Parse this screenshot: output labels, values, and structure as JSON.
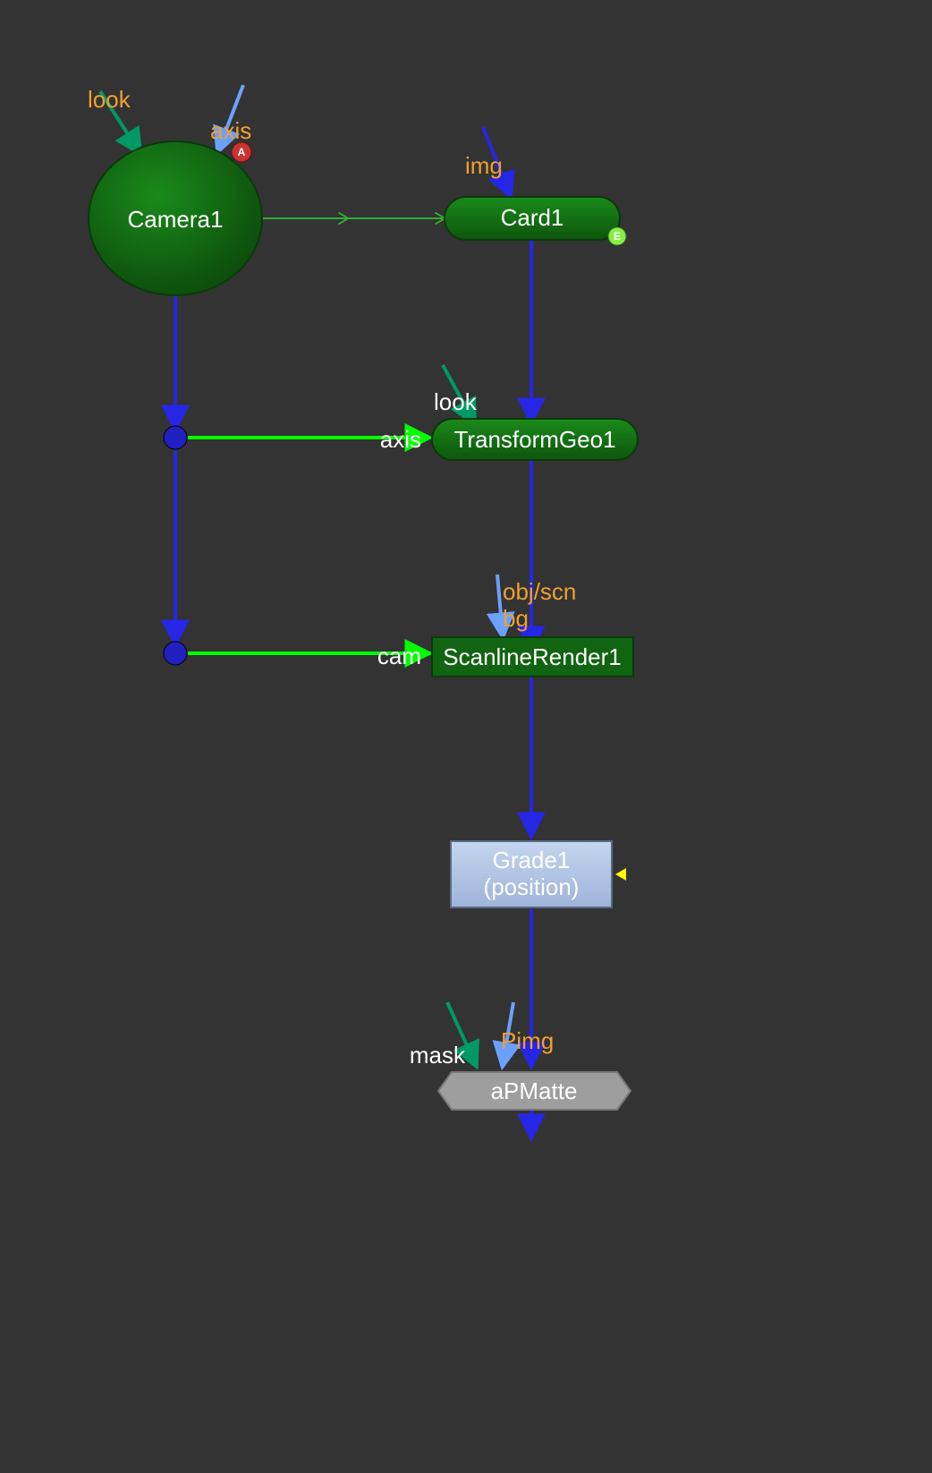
{
  "nodes": {
    "camera": {
      "label": "Camera1"
    },
    "card": {
      "label": "Card1"
    },
    "tgeo": {
      "label": "TransformGeo1"
    },
    "scanline": {
      "label": "ScanlineRender1"
    },
    "grade": {
      "label1": "Grade1",
      "label2": "(position)"
    },
    "apmatte": {
      "label": "aPMatte"
    }
  },
  "inputs": {
    "camera_look": "look",
    "camera_axis": "axis",
    "card_img": "img",
    "tgeo_look": "look",
    "tgeo_axis": "axis",
    "scan_objscn": "obj/scn",
    "scan_bg": "bg",
    "scan_cam": "cam",
    "apmatte_mask": "mask",
    "apmatte_pimg": "Pimg"
  },
  "badges": {
    "camera_a": "A",
    "card_e": "E"
  },
  "colors": {
    "bg": "#333333",
    "green_dark": "#116411",
    "green_border": "#0a3a0a",
    "green_bright": "#00ff00",
    "green_pipe": "#33aa33",
    "teal": "#009966",
    "blue_pipe": "#2626e6",
    "blue_dot": "#2020c0",
    "blue_stroke": "#6ba0ff",
    "grade_fill": "#b0c4e6",
    "grade_border": "#5a6a88",
    "grey_fill": "#9e9e9e",
    "grey_border": "#777777",
    "yellow": "#ffff00",
    "text": "#ffffff",
    "orange": "#f0a030",
    "red_badge": "#cc3333",
    "lime_badge": "#88ee44"
  }
}
